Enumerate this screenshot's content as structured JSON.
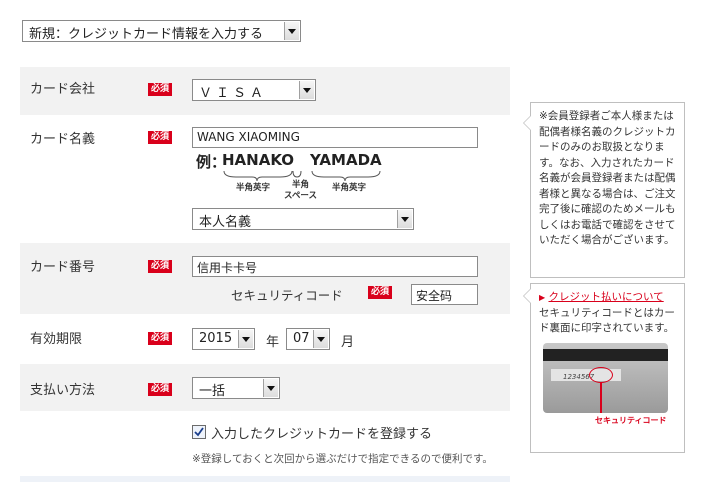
{
  "form_title_select": {
    "value": "新規：クレジットカード情報を入力する"
  },
  "required_badge": "必須",
  "rows": {
    "card_company": {
      "label": "カード会社",
      "value": "ＶＩＳＡ"
    },
    "card_holder": {
      "label": "カード名義",
      "input_value": "WANG XIAOMING",
      "example_prefix": "例：",
      "example_first": "HANAKO",
      "example_last": "YAMADA",
      "hint_first": "半角英字",
      "hint_space_1": "半角",
      "hint_space_2": "スペース",
      "hint_last": "半角英字",
      "name_type_value": "本人名義"
    },
    "card_number": {
      "label": "カード番号",
      "input_value": "信用卡卡号",
      "security_label": "セキュリティコード",
      "security_value": "安全码"
    },
    "expiry": {
      "label": "有効期限",
      "year": "2015",
      "year_unit": "年",
      "month": "07",
      "month_unit": "月"
    },
    "payment": {
      "label": "支払い方法",
      "value": "一括"
    },
    "register": {
      "checked": true,
      "label": "入力したクレジットカードを登録する",
      "note": "※登録しておくと次回から選ぶだけで指定できるので便利です。"
    }
  },
  "side_notes": {
    "holder_note": "※会員登録者ご本人様または配偶者様名義のクレジットカードのみのお取扱となります。なお、入力されたカード名義が会員登録者または配偶者様と異なる場合は、ご注文完了後に確認のためメールもしくはお電話で確認をさせていただく場合がございます。",
    "security_link": "クレジット払いについて",
    "security_text": "セキュリティコードとはカード裏面に印字されています。",
    "card_image_number": "1234567",
    "card_image_caption": "セキュリティコード"
  },
  "colors": {
    "required_red": "#d9001b",
    "band_gray": "#f2f2f2",
    "link_red": "#d9001b"
  }
}
